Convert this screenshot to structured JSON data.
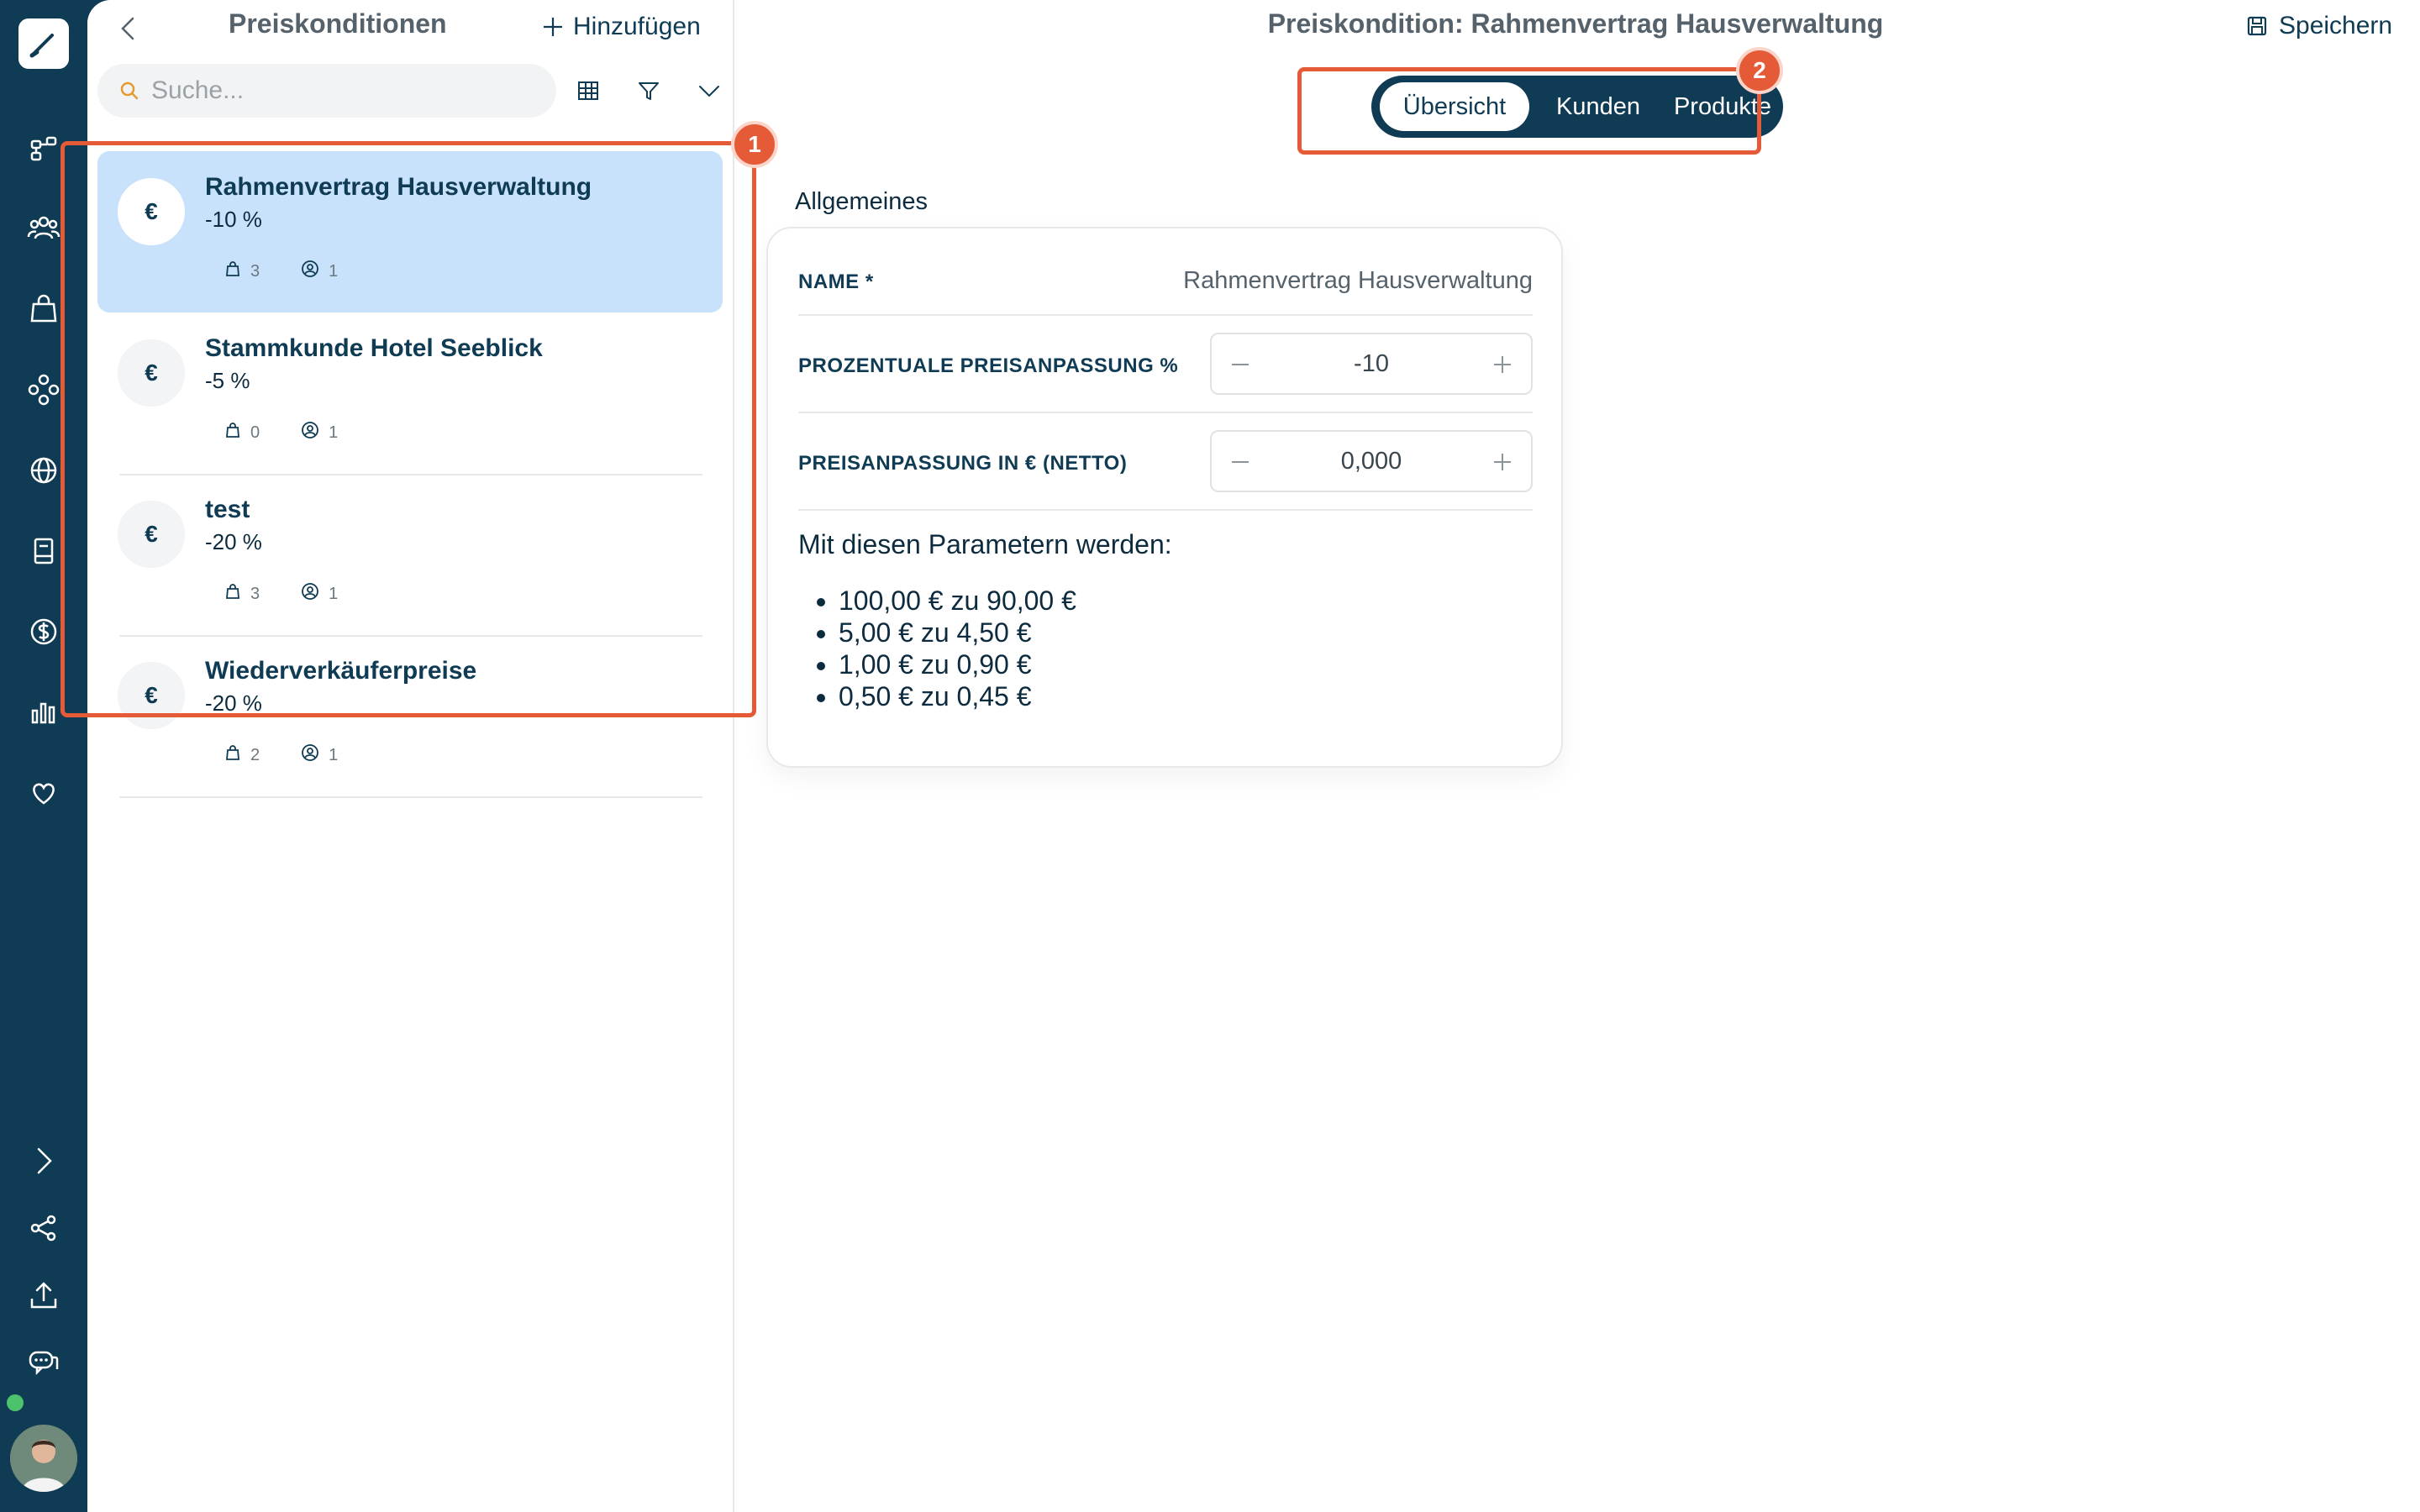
{
  "list": {
    "title": "Preiskonditionen",
    "add_label": "Hinzufügen",
    "search_placeholder": "Suche...",
    "items": [
      {
        "name": "Rahmenvertrag Hausverwaltung",
        "percent": "-10 %",
        "products": "3",
        "customers": "1",
        "badge": "€",
        "selected": true
      },
      {
        "name": "Stammkunde Hotel Seeblick",
        "percent": "-5 %",
        "products": "0",
        "customers": "1",
        "badge": "€",
        "selected": false
      },
      {
        "name": "test",
        "percent": "-20 %",
        "products": "3",
        "customers": "1",
        "badge": "€",
        "selected": false
      },
      {
        "name": "Wiederverkäuferpreise",
        "percent": "-20 %",
        "products": "2",
        "customers": "1",
        "badge": "€",
        "selected": false
      }
    ]
  },
  "detail": {
    "title": "Preiskondition: Rahmenvertrag Hausverwaltung",
    "save_label": "Speichern",
    "tabs": [
      {
        "label": "Übersicht",
        "active": true
      },
      {
        "label": "Kunden",
        "active": false
      },
      {
        "label": "Produkte",
        "active": false
      }
    ],
    "section_label": "Allgemeines",
    "fields": {
      "name_label": "NAME *",
      "name_value": "Rahmenvertrag Hausverwaltung",
      "percent_label": "PROZENTUALE PREISANPASSUNG %",
      "percent_value": "-10",
      "euro_label": "PREISANPASSUNG IN € (NETTO)",
      "euro_value": "0,000"
    },
    "info_title": "Mit diesen Parametern werden:",
    "examples": [
      "100,00 € zu 90,00 €",
      "5,00 € zu 4,50 €",
      "1,00 € zu 0,90 €",
      "0,50 € zu 0,45 €"
    ]
  },
  "annotations": [
    "1",
    "2"
  ],
  "colors": {
    "brand": "#0f3b54",
    "selected": "#c9e2fb",
    "annotation": "#e55a37",
    "online": "#4cc26c"
  }
}
